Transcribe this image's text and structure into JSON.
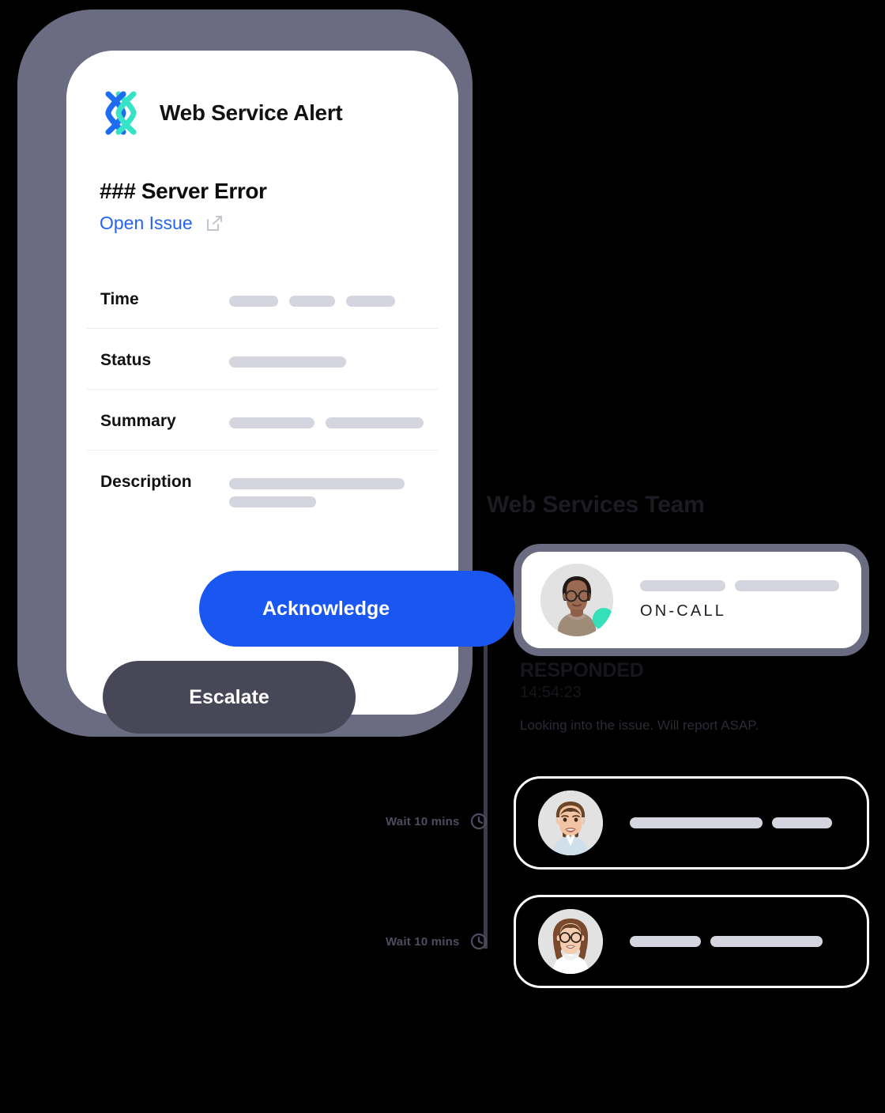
{
  "app": {
    "logo_icon": "xmatters-x-logo-icon",
    "title": "Web Service Alert"
  },
  "alert": {
    "title": "### Server Error",
    "link_label": "Open Issue",
    "link_icon": "external-link-icon",
    "rows": [
      {
        "label": "Time",
        "bars": [
          62,
          58,
          62
        ]
      },
      {
        "label": "Status",
        "bars": [
          148
        ]
      },
      {
        "label": "Summary",
        "bars": [
          108,
          124
        ]
      },
      {
        "label": "Description",
        "bars": [
          222,
          110
        ]
      }
    ]
  },
  "actions": {
    "acknowledge_label": "Acknowledge",
    "escalate_label": "Escalate"
  },
  "team": {
    "heading": "Web Services Team",
    "oncall_card": {
      "avatar_name": "avatar-oncall-responder",
      "presence_icon": "online-status-dot-icon",
      "name_bars": [
        108,
        132
      ],
      "status_label": "ON-CALL"
    },
    "responded": {
      "title": "RESPONDED",
      "time": "14:54:23",
      "message": "Looking into the issue. Will report ASAP."
    },
    "escalation_steps": [
      {
        "wait_label": "Wait 10 mins",
        "wait_icon": "clock-icon",
        "avatar_name": "avatar-escalation-1",
        "name_bars": [
          168,
          76
        ]
      },
      {
        "wait_label": "Wait 10 mins",
        "wait_icon": "clock-icon",
        "avatar_name": "avatar-escalation-2",
        "name_bars": [
          90,
          142
        ]
      }
    ]
  },
  "colors": {
    "accent_blue": "#1a56f0",
    "link_blue": "#2563f5",
    "logo_blue": "#1e6cf0",
    "logo_teal": "#36e3c6",
    "presence_teal": "#33e0b8",
    "phone_frame": "#6b6b82",
    "escalate_dark": "#474757",
    "skeleton_gray": "#d5d5e0",
    "background": "#000000"
  }
}
